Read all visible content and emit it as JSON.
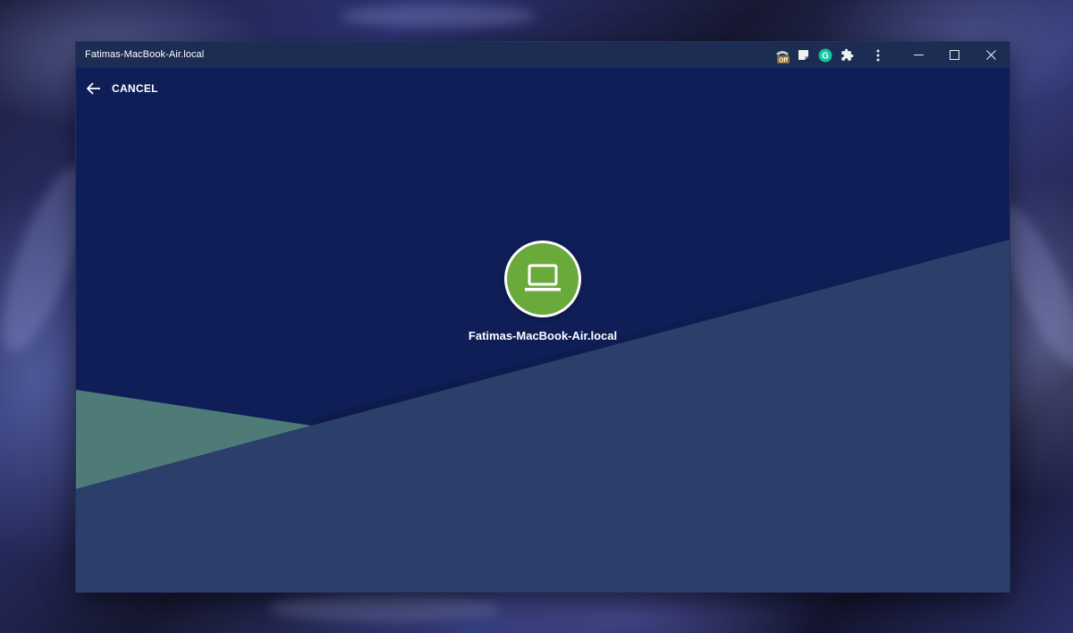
{
  "window": {
    "title": "Fatimas-MacBook-Air.local",
    "extensions": [
      {
        "icon": "off-badge-extension-icon",
        "badge": "Off"
      },
      {
        "icon": "note-extension-icon"
      },
      {
        "icon": "grammarly-extension-icon",
        "letter": "G"
      },
      {
        "icon": "puzzle-extensions-icon"
      }
    ],
    "controls": [
      "more-options-icon",
      "minimize-icon",
      "maximize-icon",
      "close-icon"
    ]
  },
  "header": {
    "back_icon": "arrow-left-icon",
    "cancel_label": "CANCEL"
  },
  "device": {
    "icon": "laptop-icon",
    "name": "Fatimas-MacBook-Air.local",
    "avatar_color": "#6aaa3b"
  },
  "colors": {
    "background_navy": "#0f1e57",
    "slope_slate": "#2b3f6a",
    "slope_teal": "#4e7b78",
    "titlebar": "#1c2c53"
  }
}
